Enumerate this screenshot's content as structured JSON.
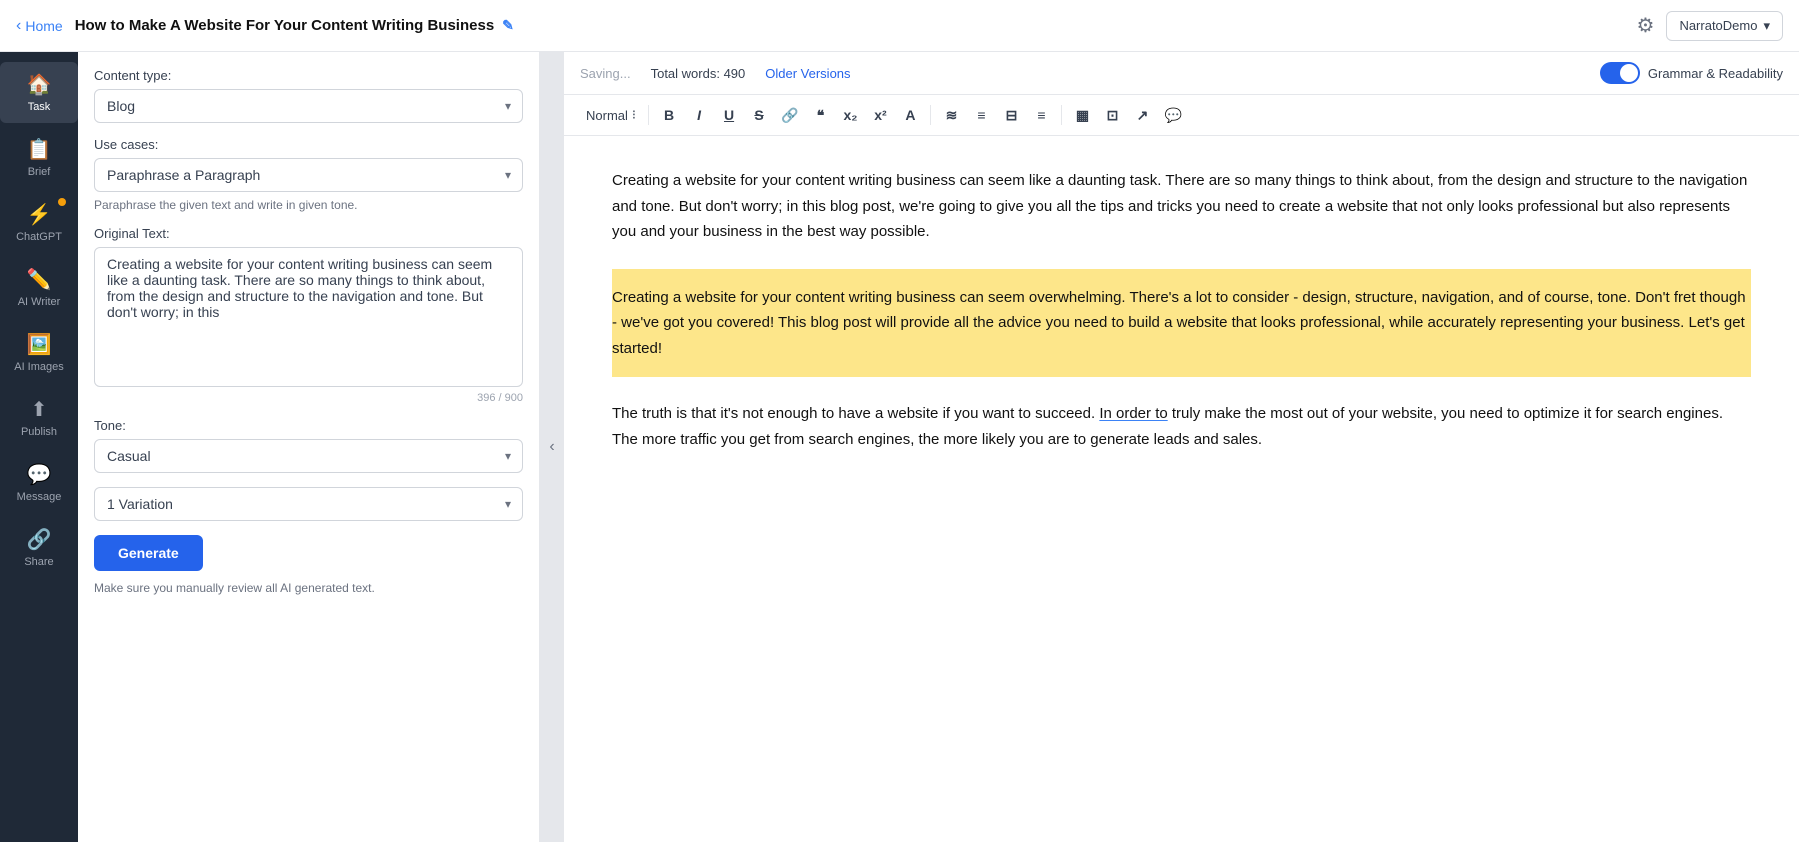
{
  "topNav": {
    "homeLabel": "Home",
    "pageTitle": "How to Make A Website For Your Content Writing Business",
    "editIconChar": "✎",
    "gearChar": "⚙",
    "userLabel": "NarratoDemo",
    "chevronLeft": "‹",
    "chevronDown": "▾"
  },
  "sidebar": {
    "items": [
      {
        "id": "task",
        "icon": "🏠",
        "label": "Task",
        "active": true
      },
      {
        "id": "brief",
        "icon": "📋",
        "label": "Brief",
        "active": false
      },
      {
        "id": "chatgpt",
        "icon": "💬",
        "label": "ChatGPT",
        "active": false,
        "badge": true
      },
      {
        "id": "ai-writer",
        "icon": "✏️",
        "label": "AI Writer",
        "active": false
      },
      {
        "id": "ai-images",
        "icon": "🖼️",
        "label": "AI Images",
        "active": false
      },
      {
        "id": "publish",
        "icon": "⬆️",
        "label": "Publish",
        "active": false
      },
      {
        "id": "message",
        "icon": "💬",
        "label": "Message",
        "active": false
      },
      {
        "id": "share",
        "icon": "🔗",
        "label": "Share",
        "active": false
      }
    ]
  },
  "leftPanel": {
    "contentTypeLabel": "Content type:",
    "contentTypeValue": "Blog",
    "useCasesLabel": "Use cases:",
    "useCasesValue": "Paraphrase a Paragraph",
    "useCaseDesc": "Paraphrase the given text and write in given tone.",
    "originalTextLabel": "Original Text:",
    "originalTextValue": "Creating a website for your content writing business can seem like a daunting task. There are so many things to think about, from the design and structure to the navigation and tone. But don't worry; in this",
    "charCount": "396 / 900",
    "toneLabel": "Tone:",
    "toneValue": "Casual",
    "variationsLabel": "1 Variation",
    "generateLabel": "Generate",
    "aiNoteLabel": "Make sure you manually review all AI generated text."
  },
  "editor": {
    "savingText": "Saving...",
    "wordCountLabel": "Total words: 490",
    "olderVersionsLabel": "Older Versions",
    "grammarLabel": "Grammar & Readability",
    "styleLabel": "Normal",
    "toolbarButtons": [
      "B",
      "I",
      "U",
      "S",
      "🔗",
      "❝",
      "x₂",
      "x²",
      "A",
      "≋",
      "≡",
      "⊟",
      "≡",
      "▦",
      "⊡",
      "↗",
      "💬"
    ],
    "para1": "Creating a website for your content writing business can seem like a daunting task. There are so many things to think about, from the design and structure to the navigation and tone. But don't worry; in this blog post, we're going to give you all the tips and tricks you need to create a website that not only looks professional but also represents you and your business in the best way possible.",
    "highlightedPara": "Creating a website for your content writing business can seem overwhelming. There's a lot to consider - design, structure, navigation, and of course, tone. Don't fret though - we've got you covered! This blog post will provide all the advice you need to build a website that looks professional, while accurately representing your business. Let's get started!",
    "para2": "The truth is that it's not enough to have a website if you want to succeed. In order to truly make the most out of your website, you need to optimize it for search engines. The more traffic you get from search engines, the more likely you are to generate leads and sales.",
    "underlineBlueText": "In order to"
  }
}
